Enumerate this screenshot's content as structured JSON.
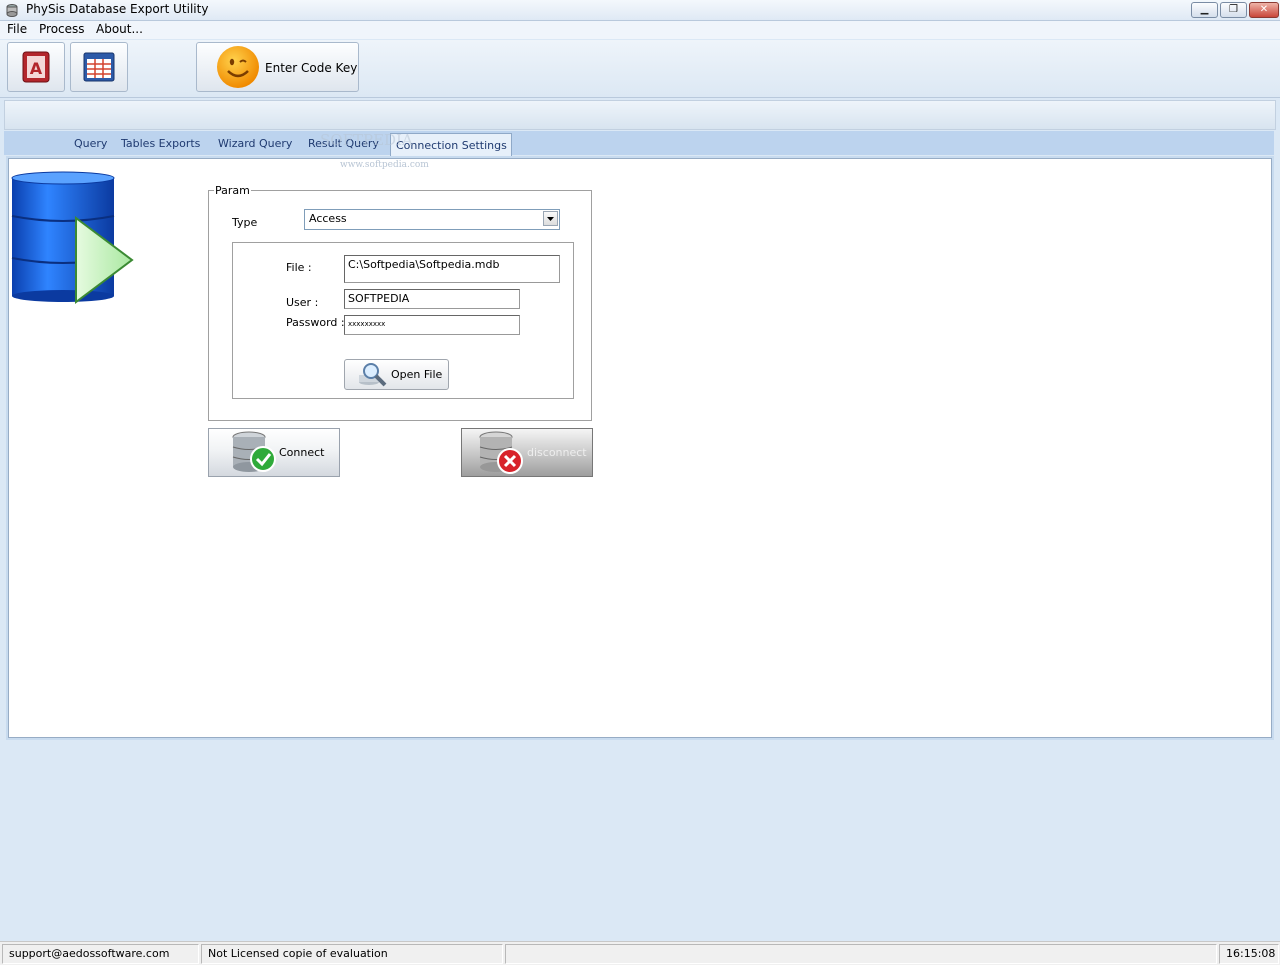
{
  "window": {
    "title": "PhySis Database Export Utility"
  },
  "menu": {
    "file": "File",
    "process": "Process",
    "about": "About..."
  },
  "toolbar": {
    "enter_code_key": "Enter Code Key"
  },
  "tabs": {
    "query": "Query",
    "tables_exports": "Tables Exports",
    "wizard_query": "Wizard Query",
    "result_query": "Result Query",
    "connection_settings": "Connection Settings"
  },
  "watermark": {
    "brand": "SOFTPEDIA",
    "url": "www.softpedia.com"
  },
  "param": {
    "legend": "Param",
    "type_label": "Type",
    "type_value": "Access",
    "file_label": "File :",
    "file_value": "C:\\Softpedia\\Softpedia.mdb",
    "user_label": "User :",
    "user_value": "SOFTPEDIA",
    "password_label": "Password :",
    "password_value": "xxxxxxxxx",
    "open_file": "Open File"
  },
  "buttons": {
    "connect": "Connect",
    "disconnect": "disconnect"
  },
  "status": {
    "email": "support@aedossoftware.com",
    "license": "Not Licensed copie of evaluation",
    "time": "16:15:08"
  }
}
